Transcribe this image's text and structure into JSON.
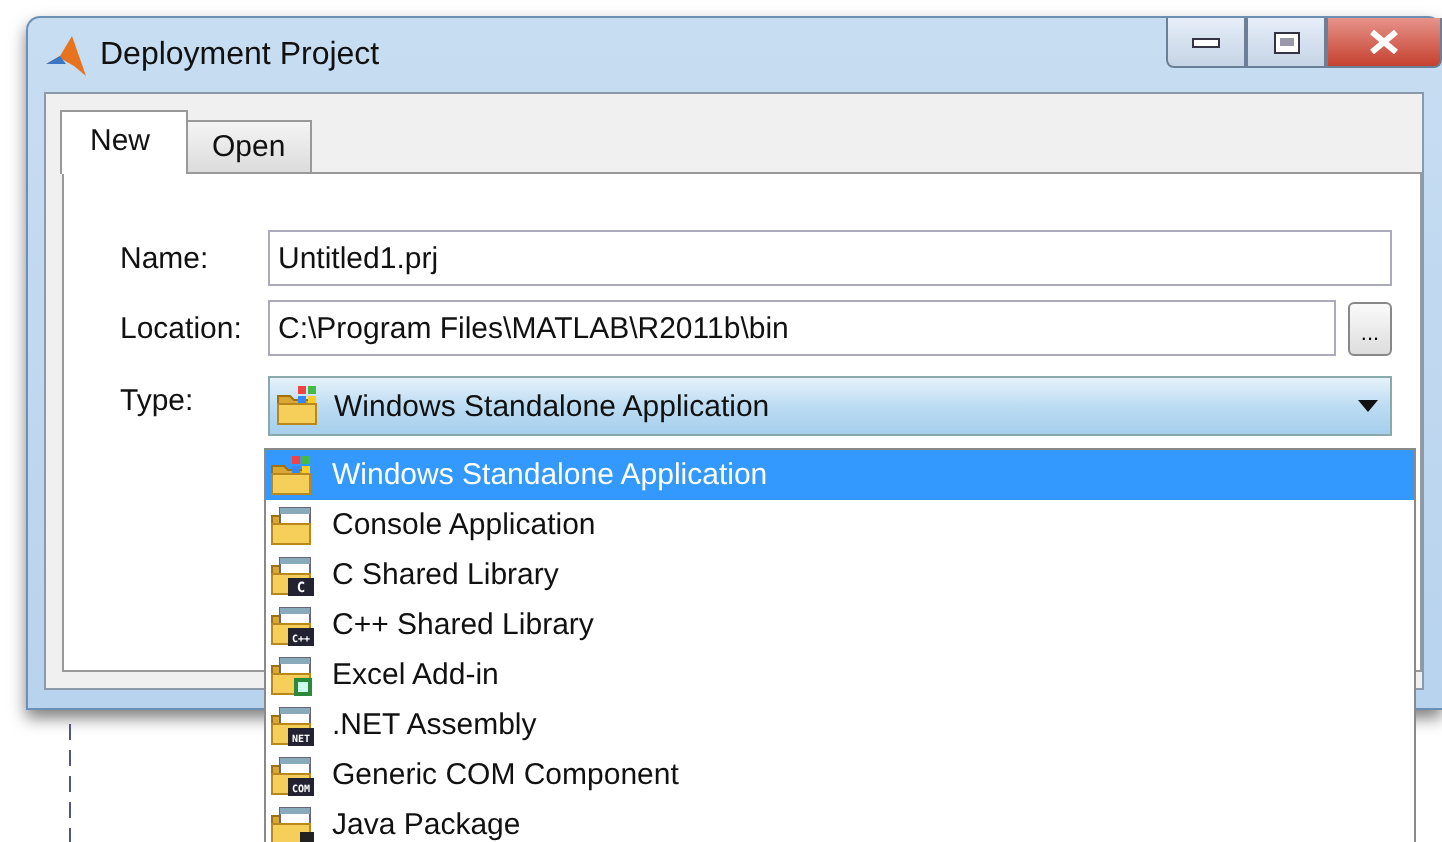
{
  "window": {
    "title": "Deployment Project"
  },
  "tabs": [
    {
      "label": "New",
      "selected": true
    },
    {
      "label": "Open",
      "selected": false
    }
  ],
  "form": {
    "name": {
      "label": "Name:",
      "value": "Untitled1.prj"
    },
    "location": {
      "label": "Location:",
      "value": "C:\\Program Files\\MATLAB\\R2011b\\bin",
      "browse": "..."
    },
    "type": {
      "label": "Type:",
      "value": "Windows Standalone Application",
      "expanded": true
    }
  },
  "type_options": [
    {
      "label": "Windows Standalone Application",
      "kind": "standalone",
      "selected": true
    },
    {
      "label": "Console Application",
      "kind": "console",
      "selected": false
    },
    {
      "label": "C Shared Library",
      "kind": "badge",
      "badge": "C",
      "selected": false
    },
    {
      "label": "C++ Shared Library",
      "kind": "badge",
      "badge": "C++",
      "selected": false
    },
    {
      "label": "Excel Add-in",
      "kind": "excel",
      "selected": false
    },
    {
      "label": ".NET Assembly",
      "kind": "badge",
      "badge": "NET",
      "selected": false
    },
    {
      "label": "Generic COM Component",
      "kind": "badge",
      "badge": "COM",
      "selected": false
    },
    {
      "label": "Java Package",
      "kind": "java",
      "selected": false
    }
  ]
}
